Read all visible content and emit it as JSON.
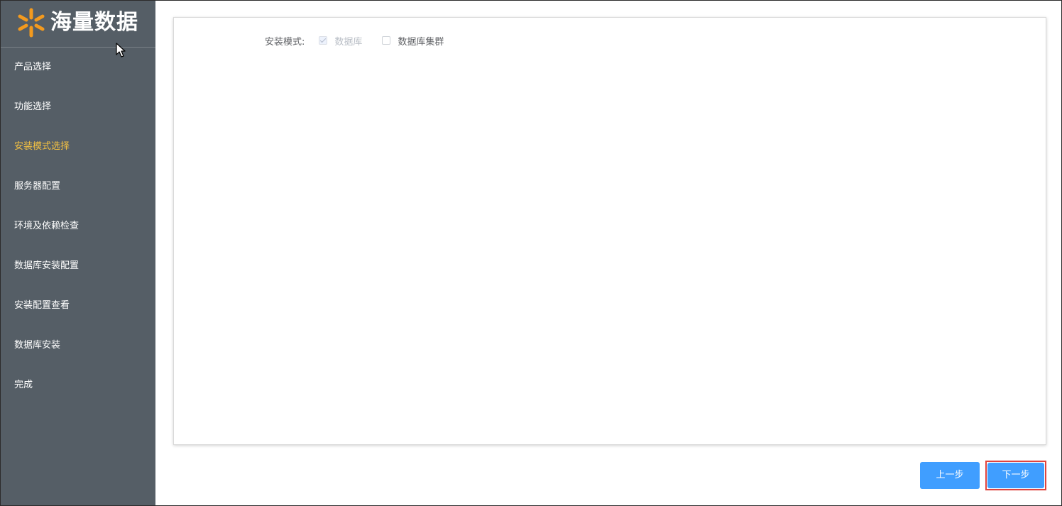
{
  "brand": {
    "name": "海量数据",
    "icon": "vastdata-logo-icon",
    "accent_color": "#f39a1e"
  },
  "sidebar": {
    "background": "#555e66",
    "active_color": "#f5c242",
    "items": [
      {
        "label": "产品选择",
        "active": false
      },
      {
        "label": "功能选择",
        "active": false
      },
      {
        "label": "安装模式选择",
        "active": true
      },
      {
        "label": "服务器配置",
        "active": false
      },
      {
        "label": "环境及依赖检查",
        "active": false
      },
      {
        "label": "数据库安装配置",
        "active": false
      },
      {
        "label": "安装配置查看",
        "active": false
      },
      {
        "label": "数据库安装",
        "active": false
      },
      {
        "label": "完成",
        "active": false
      }
    ]
  },
  "main": {
    "install_mode": {
      "label": "安装模式:",
      "options": [
        {
          "label": "数据库",
          "checked": true,
          "disabled": true
        },
        {
          "label": "数据库集群",
          "checked": false,
          "disabled": false
        }
      ]
    }
  },
  "footer": {
    "prev_label": "上一步",
    "next_label": "下一步",
    "button_color": "#409eff",
    "highlight_color": "#e0443e"
  }
}
